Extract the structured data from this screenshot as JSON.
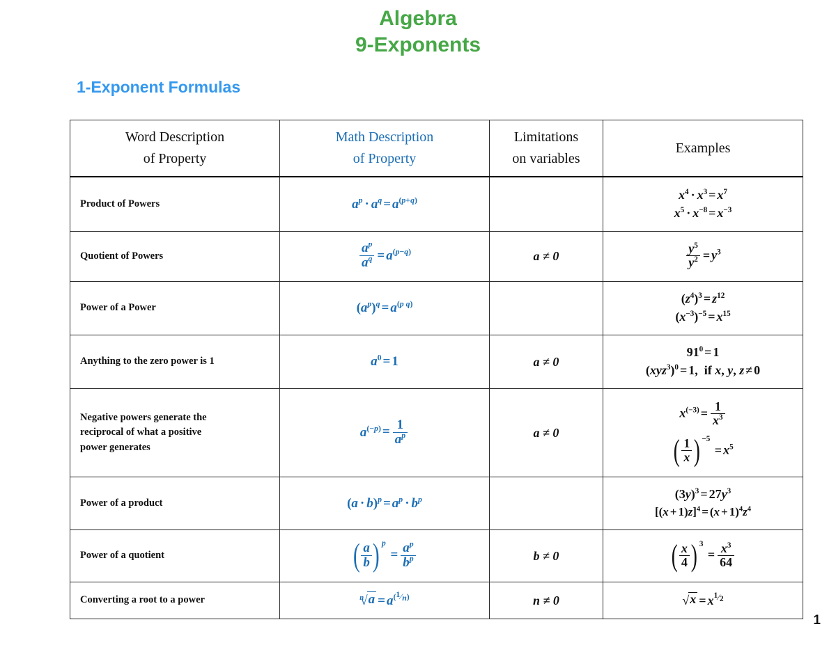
{
  "header": {
    "title_line1": "Algebra",
    "title_line2": "9-Exponents",
    "title_color": "#46a746",
    "section_heading": "1-Exponent Formulas",
    "section_color": "#3498ee"
  },
  "colors": {
    "math_blue": "#1c6eb4",
    "text_black": "#111111",
    "border": "#2b2b2b"
  },
  "table": {
    "columns": [
      {
        "line1": "Word Description",
        "line2": "of Property",
        "color": "#111111"
      },
      {
        "line1": "Math Description",
        "line2": "of Property",
        "color": "#1c6eb4"
      },
      {
        "line1": "Limitations",
        "line2": "on variables",
        "color": "#111111"
      },
      {
        "line1": "Examples",
        "line2": "",
        "color": "#111111"
      }
    ],
    "rows": [
      {
        "word": "Product of Powers",
        "math_text": "a^p · a^q = a^(p+q)",
        "limitation": "",
        "examples_text": [
          "x^4 · x^3 = x^7",
          "x^5 · x^-8 = x^-3"
        ]
      },
      {
        "word": "Quotient of Powers",
        "math_text": "a^p / a^q = a^(p-q)",
        "limitation": "a ≠ 0",
        "examples_text": [
          "y^5 / y^2 = y^3"
        ]
      },
      {
        "word": "Power of a Power",
        "math_text": "(a^p)^q = a^(p q)",
        "limitation": "",
        "examples_text": [
          "(z^4)^3 = z^12",
          "(x^-3)^-5 = x^15"
        ]
      },
      {
        "word": "Anything to the zero power is 1",
        "math_text": "a^0 = 1",
        "limitation": "a ≠ 0",
        "examples_text": [
          "91^0 = 1",
          "(xyz^3)^0 = 1,  if x, y, z ≠ 0"
        ]
      },
      {
        "word_lines": [
          "Negative powers generate the",
          "reciprocal of what a positive",
          "power generates"
        ],
        "word": "Negative powers generate the reciprocal of what a positive power generates",
        "math_text": "a^(-p) = 1 / a^p",
        "limitation": "a ≠ 0",
        "examples_text": [
          "x^(-3) = 1 / x^3",
          "(1/x)^-5 = x^5"
        ]
      },
      {
        "word": "Power of a product",
        "math_text": "(a · b)^p = a^p · b^p",
        "limitation": "",
        "examples_text": [
          "(3y)^3 = 27y^3",
          "[(x + 1)z]^4 = (x + 1)^4 z^4"
        ]
      },
      {
        "word": "Power of a quotient",
        "math_text": "(a/b)^p = a^p / b^p",
        "limitation": "b ≠ 0",
        "examples_text": [
          "(x/4)^3 = x^3 / 64"
        ]
      },
      {
        "word": "Converting a root to a power",
        "math_text": "n-th root of a = a^(1/n)",
        "limitation": "n ≠ 0",
        "examples_text": [
          "sqrt(x) = x^(1/2)"
        ]
      }
    ]
  },
  "footer": {
    "page_number": "1"
  }
}
